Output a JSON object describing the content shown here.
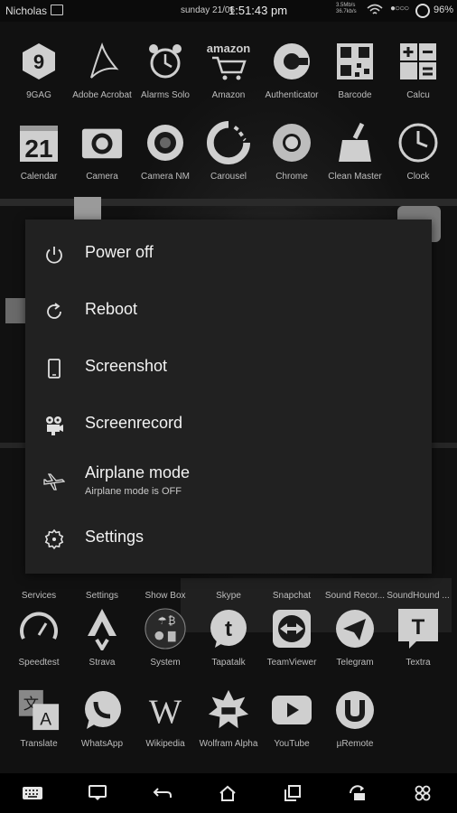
{
  "status_bar": {
    "owner": "Nicholas",
    "date": "sunday 21/06",
    "time": "1:51:43 pm",
    "net_up": "3.5Mb/s",
    "net_down": "36.7kb/s",
    "battery": "96%"
  },
  "apps_row1": [
    {
      "label": "9GAG",
      "icon": "9gag-icon"
    },
    {
      "label": "Adobe Acrobat",
      "icon": "acrobat-icon"
    },
    {
      "label": "Alarms Solo",
      "icon": "alarm-clock-icon"
    },
    {
      "label": "Amazon",
      "icon": "amazon-cart-icon"
    },
    {
      "label": "Authenticator",
      "icon": "authenticator-icon"
    },
    {
      "label": "Barcode",
      "icon": "qr-code-icon"
    },
    {
      "label": "Calcu",
      "icon": "calculator-icon"
    }
  ],
  "apps_row2": [
    {
      "label": "Calendar",
      "icon": "calendar-icon",
      "text": "21"
    },
    {
      "label": "Camera",
      "icon": "camera-icon"
    },
    {
      "label": "Camera NM",
      "icon": "camera-lens-icon"
    },
    {
      "label": "Carousel",
      "icon": "carousel-icon"
    },
    {
      "label": "Chrome",
      "icon": "chrome-icon"
    },
    {
      "label": "Clean Master",
      "icon": "broom-icon"
    },
    {
      "label": "Clock",
      "icon": "clock-icon"
    }
  ],
  "apps_row_services": [
    {
      "label": "Services"
    },
    {
      "label": "Settings"
    },
    {
      "label": "Show Box"
    },
    {
      "label": "Skype"
    },
    {
      "label": "Snapchat"
    },
    {
      "label": "Sound Recor..."
    },
    {
      "label": "SoundHound ..."
    }
  ],
  "apps_row4": [
    {
      "label": "Speedtest",
      "icon": "speedometer-icon"
    },
    {
      "label": "Strava",
      "icon": "strava-icon"
    },
    {
      "label": "System",
      "icon": "system-icon"
    },
    {
      "label": "Tapatalk",
      "icon": "tapatalk-icon",
      "text": "t"
    },
    {
      "label": "TeamViewer",
      "icon": "teamviewer-icon"
    },
    {
      "label": "Telegram",
      "icon": "paper-plane-icon"
    },
    {
      "label": "Textra",
      "icon": "textra-icon",
      "text": "T"
    }
  ],
  "apps_row5": [
    {
      "label": "Translate",
      "icon": "translate-icon"
    },
    {
      "label": "WhatsApp",
      "icon": "whatsapp-icon"
    },
    {
      "label": "Wikipedia",
      "icon": "wikipedia-icon",
      "text": "W"
    },
    {
      "label": "Wolfram Alpha",
      "icon": "wolfram-icon"
    },
    {
      "label": "YouTube",
      "icon": "youtube-icon"
    },
    {
      "label": "µRemote",
      "icon": "utorrent-icon"
    }
  ],
  "power_menu": {
    "items": [
      {
        "label": "Power off",
        "icon": "power-icon"
      },
      {
        "label": "Reboot",
        "icon": "reboot-icon"
      },
      {
        "label": "Screenshot",
        "icon": "phone-icon"
      },
      {
        "label": "Screenrecord",
        "icon": "camcorder-icon"
      },
      {
        "label": "Airplane mode",
        "sublabel": "Airplane mode is OFF",
        "icon": "airplane-icon"
      },
      {
        "label": "Settings",
        "icon": "gear-icon"
      }
    ]
  },
  "nav_bar": {
    "buttons": [
      "keyboard-icon",
      "notes-icon",
      "back-icon",
      "home-icon",
      "recents-icon",
      "rotate-icon",
      "apps-icon"
    ]
  }
}
